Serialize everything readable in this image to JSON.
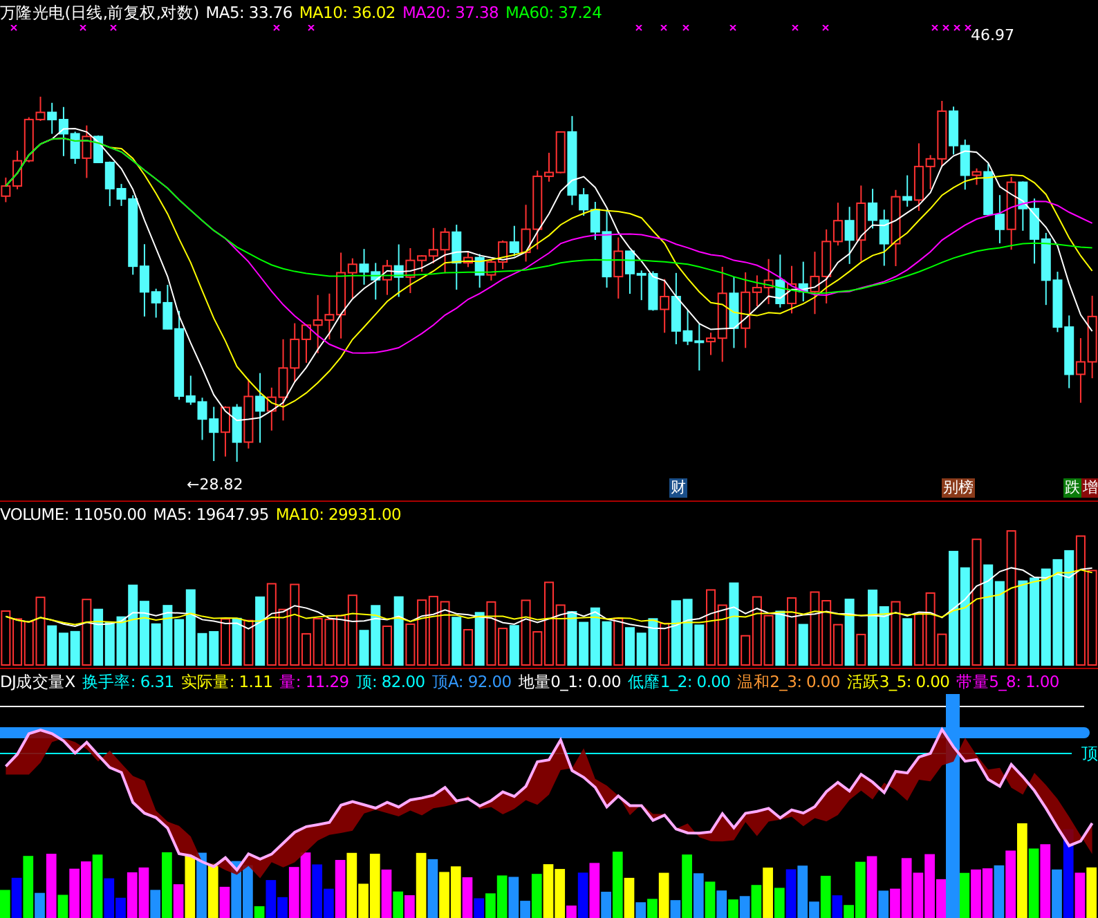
{
  "price_panel": {
    "title": "万隆光电(日线,前复权,对数)",
    "indicators": [
      {
        "label": "MA5: 33.76",
        "color": "#ffffff"
      },
      {
        "label": "MA10: 36.02",
        "color": "#ffff00"
      },
      {
        "label": "MA20: 37.38",
        "color": "#ff00ff"
      },
      {
        "label": "MA60: 37.24",
        "color": "#00ff00"
      }
    ],
    "high_label": "46.97",
    "low_label": "←28.82",
    "event_tags": [
      {
        "text": "财",
        "color": "#1a4f8a"
      },
      {
        "text": "别榜",
        "color": "#8a3a1a"
      },
      {
        "text": "跌",
        "color": "#0a7a0a"
      },
      {
        "text": "增",
        "color": "#8a0a0a"
      }
    ]
  },
  "volume_panel": {
    "indicators": [
      {
        "label": "VOLUME: 11050.00",
        "color": "#ffffff"
      },
      {
        "label": "MA5: 19647.95",
        "color": "#ffffff"
      },
      {
        "label": "MA10: 29931.00",
        "color": "#ffff00"
      }
    ]
  },
  "indicator_panel": {
    "title": "DJ成交量X",
    "indicators": [
      {
        "label": "换手率: 6.31",
        "color": "#00ffff"
      },
      {
        "label": "实际量: 1.11",
        "color": "#ffff00"
      },
      {
        "label": "量: 11.29",
        "color": "#ff00ff"
      },
      {
        "label": "顶: 82.00",
        "color": "#00ffff"
      },
      {
        "label": "顶A: 92.00",
        "color": "#3399ff"
      },
      {
        "label": "地量0_1: 0.00",
        "color": "#ffffff"
      },
      {
        "label": "低靡1_2: 0.00",
        "color": "#00ffff"
      },
      {
        "label": "温和2_3: 0.00",
        "color": "#ff9933"
      },
      {
        "label": "活跃3_5: 0.00",
        "color": "#ffff00"
      },
      {
        "label": "带量5_8: 1.00",
        "color": "#ff00ff"
      }
    ],
    "right_label": "顶"
  }
}
